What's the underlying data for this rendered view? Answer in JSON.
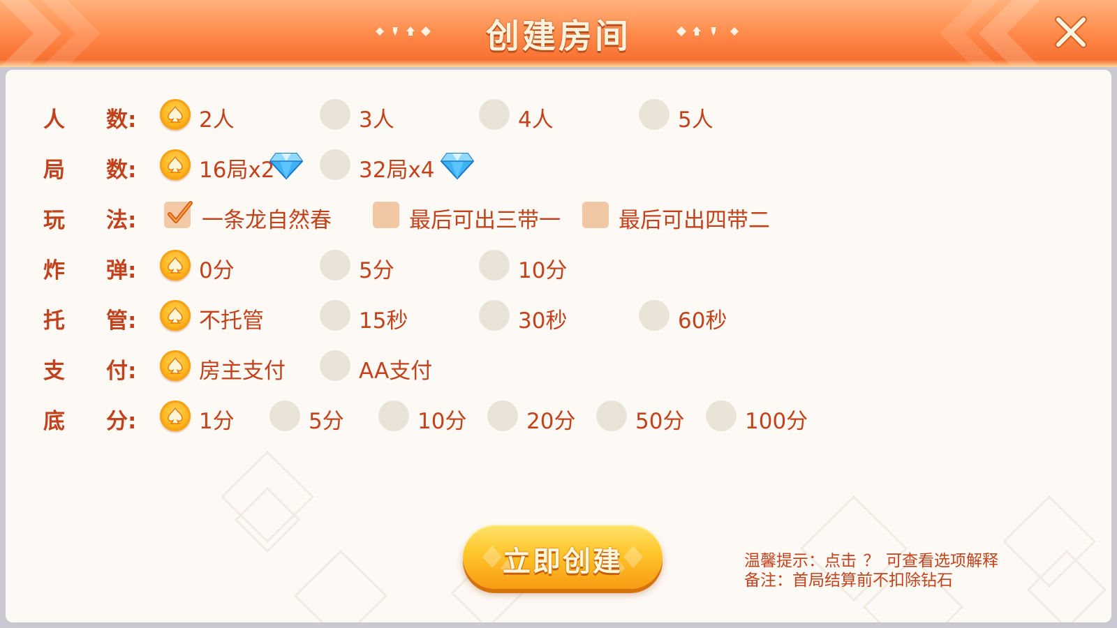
{
  "header": {
    "title": "创建房间",
    "close_icon": "close-icon"
  },
  "colors": {
    "header_top": "#ffb27b",
    "header_bottom": "#f36a2b",
    "label_text": "#c1421d",
    "radio_selected": "#ffb51c",
    "radio_unselected": "#e9e3d8",
    "panel_bg": "#fdf9f4"
  },
  "rows": {
    "players": {
      "label_1": "人",
      "label_2": "数:",
      "options": [
        {
          "text": "2人",
          "selected": true
        },
        {
          "text": "3人",
          "selected": false
        },
        {
          "text": "4人",
          "selected": false
        },
        {
          "text": "5人",
          "selected": false
        }
      ]
    },
    "rounds": {
      "label_1": "局",
      "label_2": "数:",
      "options": [
        {
          "text": "16局x2",
          "selected": true,
          "icon": "diamond-icon"
        },
        {
          "text": "32局x4",
          "selected": false,
          "icon": "diamond-icon"
        }
      ]
    },
    "rules": {
      "label_1": "玩",
      "label_2": "法:",
      "options": [
        {
          "text": "一条龙自然春",
          "checked": true
        },
        {
          "text": "最后可出三带一",
          "checked": false
        },
        {
          "text": "最后可出四带二",
          "checked": false
        }
      ]
    },
    "bomb": {
      "label_1": "炸",
      "label_2": "弹:",
      "options": [
        {
          "text": "0分",
          "selected": true
        },
        {
          "text": "5分",
          "selected": false
        },
        {
          "text": "10分",
          "selected": false
        }
      ]
    },
    "auto": {
      "label_1": "托",
      "label_2": "管:",
      "options": [
        {
          "text": "不托管",
          "selected": true
        },
        {
          "text": "15秒",
          "selected": false
        },
        {
          "text": "30秒",
          "selected": false
        },
        {
          "text": "60秒",
          "selected": false
        }
      ]
    },
    "payment": {
      "label_1": "支",
      "label_2": "付:",
      "options": [
        {
          "text": "房主支付",
          "selected": true
        },
        {
          "text": "AA支付",
          "selected": false
        }
      ]
    },
    "base": {
      "label_1": "底",
      "label_2": "分:",
      "options": [
        {
          "text": "1分",
          "selected": true
        },
        {
          "text": "5分",
          "selected": false
        },
        {
          "text": "10分",
          "selected": false
        },
        {
          "text": "20分",
          "selected": false
        },
        {
          "text": "50分",
          "selected": false
        },
        {
          "text": "100分",
          "selected": false
        }
      ]
    }
  },
  "create_button": {
    "label": "立即创建"
  },
  "hints": {
    "line1_prefix": "温馨提示：点击",
    "line1_q": "？",
    "line1_suffix": "可查看选项解释",
    "line2": "备注：首局结算前不扣除钻石"
  }
}
